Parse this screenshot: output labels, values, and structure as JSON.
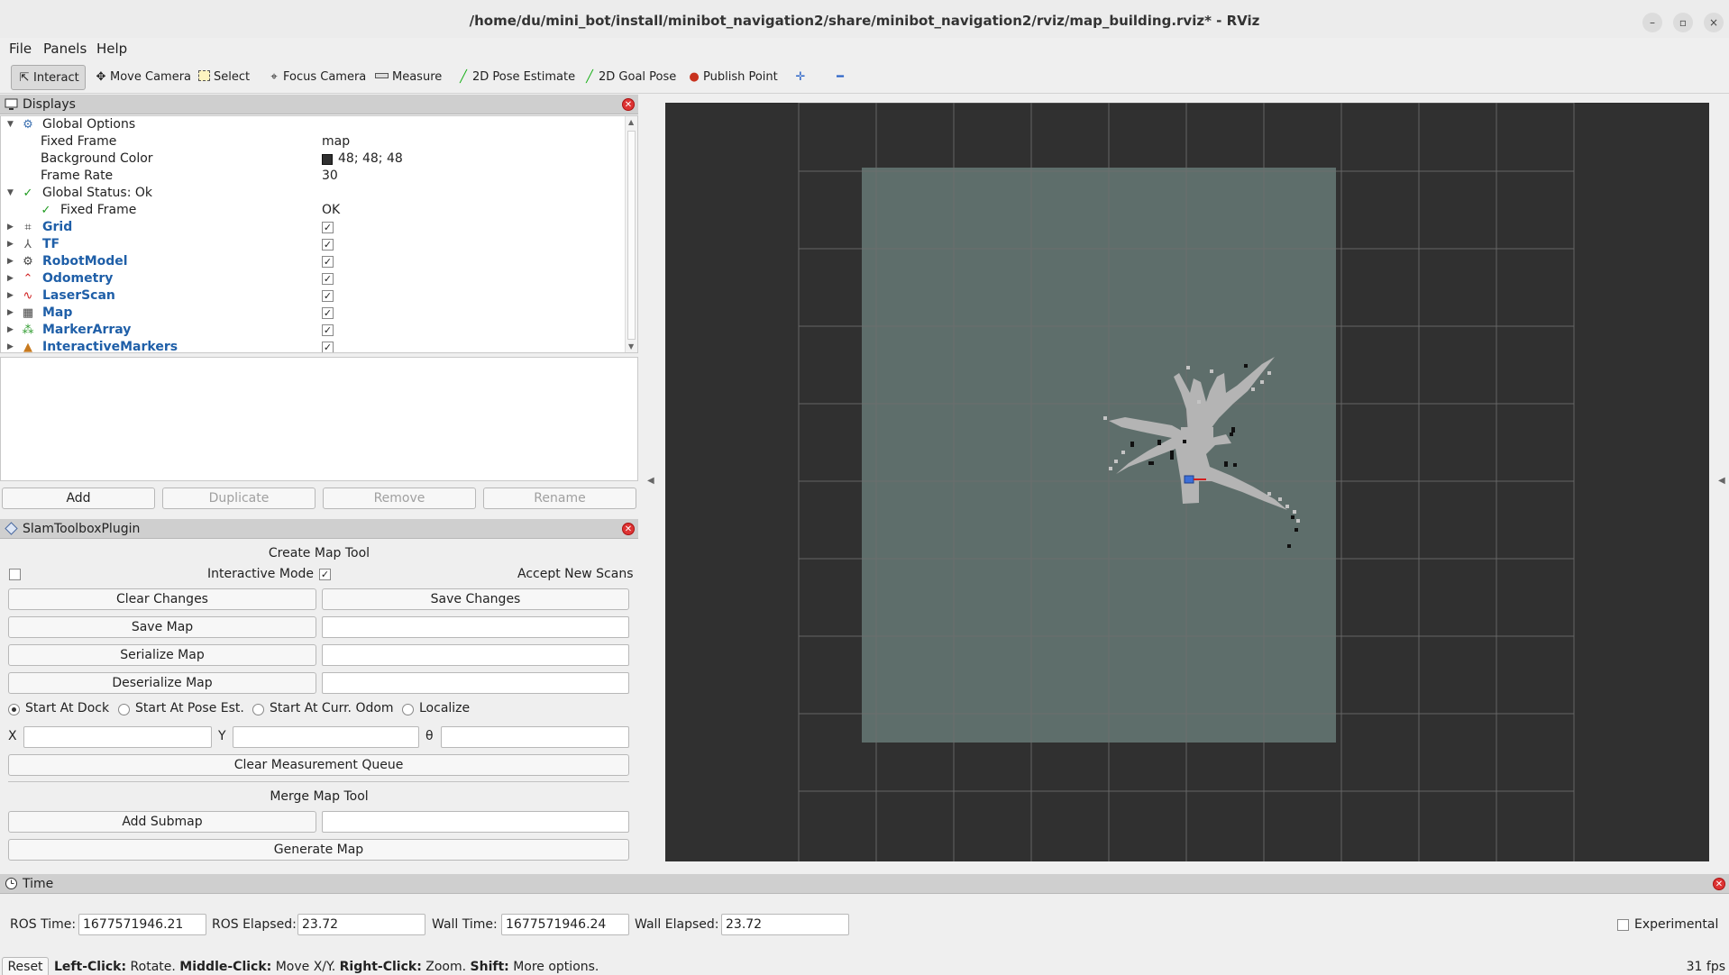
{
  "window": {
    "title": "/home/du/mini_bot/install/minibot_navigation2/share/minibot_navigation2/rviz/map_building.rviz* - RViz",
    "controls": {
      "minimize": "–",
      "maximize": "▫",
      "close": "×"
    }
  },
  "menubar": {
    "file": "File",
    "panels": "Panels",
    "help": "Help"
  },
  "toolbar": {
    "interact": "Interact",
    "move_camera": "Move Camera",
    "select": "Select",
    "focus_camera": "Focus Camera",
    "measure": "Measure",
    "pose_estimate": "2D Pose Estimate",
    "goal_pose": "2D Goal Pose",
    "publish_point": "Publish Point"
  },
  "displays": {
    "title": "Displays",
    "global_options": "Global Options",
    "fixed_frame_label": "Fixed Frame",
    "fixed_frame_value": "map",
    "background_color_label": "Background Color",
    "background_color_value": "48; 48; 48",
    "frame_rate_label": "Frame Rate",
    "frame_rate_value": "30",
    "global_status": "Global Status: Ok",
    "status_fixed_frame_label": "Fixed Frame",
    "status_fixed_frame_value": "OK",
    "items": [
      {
        "label": "Grid",
        "checked": true,
        "icon": "grid-icon"
      },
      {
        "label": "TF",
        "checked": true,
        "icon": "tf-icon"
      },
      {
        "label": "RobotModel",
        "checked": true,
        "icon": "robot-model-icon"
      },
      {
        "label": "Odometry",
        "checked": true,
        "icon": "odometry-icon"
      },
      {
        "label": "LaserScan",
        "checked": true,
        "icon": "laser-scan-icon"
      },
      {
        "label": "Map",
        "checked": true,
        "icon": "map-icon"
      },
      {
        "label": "MarkerArray",
        "checked": true,
        "icon": "marker-array-icon"
      },
      {
        "label": "InteractiveMarkers",
        "checked": true,
        "icon": "interactive-markers-icon"
      }
    ],
    "buttons": {
      "add": "Add",
      "duplicate": "Duplicate",
      "remove": "Remove",
      "rename": "Rename"
    }
  },
  "slam": {
    "title": "SlamToolboxPlugin",
    "create_map_tool": "Create Map Tool",
    "interactive_mode": "Interactive Mode",
    "interactive_mode_checked": false,
    "accept_new_scans": "Accept New Scans",
    "accept_new_scans_checked": true,
    "clear_changes": "Clear Changes",
    "save_changes": "Save Changes",
    "save_map": "Save Map",
    "serialize_map": "Serialize Map",
    "deserialize_map": "Deserialize Map",
    "start_at_dock": "Start At Dock",
    "start_at_pose_est": "Start At Pose Est.",
    "start_at_curr_odom": "Start At Curr. Odom",
    "localize": "Localize",
    "selected_mode": "Start At Dock",
    "x_label": "X",
    "y_label": "Y",
    "theta_label": "θ",
    "clear_measurement_queue": "Clear Measurement Queue",
    "merge_map_tool": "Merge Map Tool",
    "add_submap": "Add Submap",
    "generate_map": "Generate Map"
  },
  "time": {
    "title": "Time",
    "ros_time_label": "ROS Time:",
    "ros_time": "1677571946.21",
    "ros_elapsed_label": "ROS Elapsed:",
    "ros_elapsed": "23.72",
    "wall_time_label": "Wall Time:",
    "wall_time": "1677571946.24",
    "wall_elapsed_label": "Wall Elapsed:",
    "wall_elapsed": "23.72",
    "experimental": "Experimental",
    "experimental_checked": false
  },
  "statusbar": {
    "reset": "Reset",
    "left_click": "Left-Click:",
    "rotate": "Rotate.",
    "middle_click": "Middle-Click:",
    "move_xy": "Move X/Y.",
    "right_click": "Right-Click:",
    "zoom": "Zoom.",
    "shift": "Shift:",
    "more_options": "More options.",
    "fps": "31 fps"
  },
  "colors": {
    "viewport_background": "#303030",
    "map_unknown": "#5e6e6b",
    "map_free": "#b4b4b4",
    "map_occupied": "#101010",
    "grid_lines": "#6f6f6f",
    "plugin_name": "#1f5fa8"
  }
}
